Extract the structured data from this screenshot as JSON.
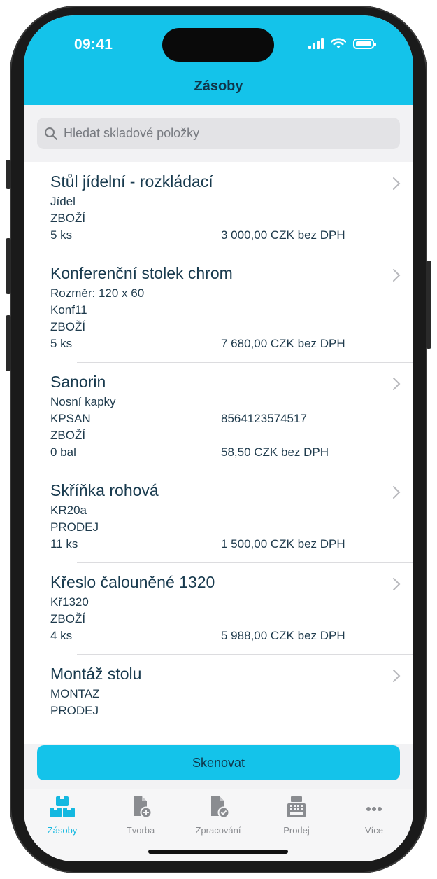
{
  "status_bar": {
    "time": "09:41"
  },
  "header": {
    "title": "Zásoby"
  },
  "search": {
    "placeholder": "Hledat skladové položky",
    "value": ""
  },
  "items": [
    {
      "name": "Stůl jídelní - rozkládací",
      "lines": [
        {
          "left": "Jídel",
          "right": ""
        },
        {
          "left": "ZBOŽÍ",
          "right": ""
        },
        {
          "left": "5 ks",
          "right": "3 000,00 CZK bez DPH"
        }
      ]
    },
    {
      "name": "Konferenční stolek chrom",
      "lines": [
        {
          "left": "Rozměr: 120 x 60",
          "right": ""
        },
        {
          "left": "Konf11",
          "right": ""
        },
        {
          "left": "ZBOŽÍ",
          "right": ""
        },
        {
          "left": "5 ks",
          "right": "7 680,00 CZK bez DPH"
        }
      ]
    },
    {
      "name": "Sanorin",
      "lines": [
        {
          "left": "Nosní kapky",
          "right": ""
        },
        {
          "left": "KPSAN",
          "right": "8564123574517"
        },
        {
          "left": "ZBOŽÍ",
          "right": ""
        },
        {
          "left": "0 bal",
          "right": "58,50 CZK bez DPH"
        }
      ]
    },
    {
      "name": "Skříňka rohová",
      "lines": [
        {
          "left": "KR20a",
          "right": ""
        },
        {
          "left": "PRODEJ",
          "right": ""
        },
        {
          "left": "11 ks",
          "right": "1 500,00 CZK bez DPH"
        }
      ]
    },
    {
      "name": "Křeslo čalouněné 1320",
      "lines": [
        {
          "left": "Kř1320",
          "right": ""
        },
        {
          "left": "ZBOŽÍ",
          "right": ""
        },
        {
          "left": "4 ks",
          "right": "5 988,00 CZK bez DPH"
        }
      ]
    },
    {
      "name": "Montáž stolu",
      "lines": [
        {
          "left": "MONTAZ",
          "right": ""
        },
        {
          "left": "PRODEJ",
          "right": ""
        }
      ]
    }
  ],
  "scan_button": {
    "label": "Skenovat"
  },
  "tabs": [
    {
      "label": "Zásoby",
      "icon": "boxes-icon",
      "active": true
    },
    {
      "label": "Tvorba",
      "icon": "document-add-icon",
      "active": false
    },
    {
      "label": "Zpracování",
      "icon": "document-check-icon",
      "active": false
    },
    {
      "label": "Prodej",
      "icon": "cash-register-icon",
      "active": false
    },
    {
      "label": "Více",
      "icon": "more-icon",
      "active": false
    }
  ],
  "colors": {
    "accent": "#14c3ea",
    "text": "#183a4e",
    "tab_inactive": "#8a8c90"
  }
}
